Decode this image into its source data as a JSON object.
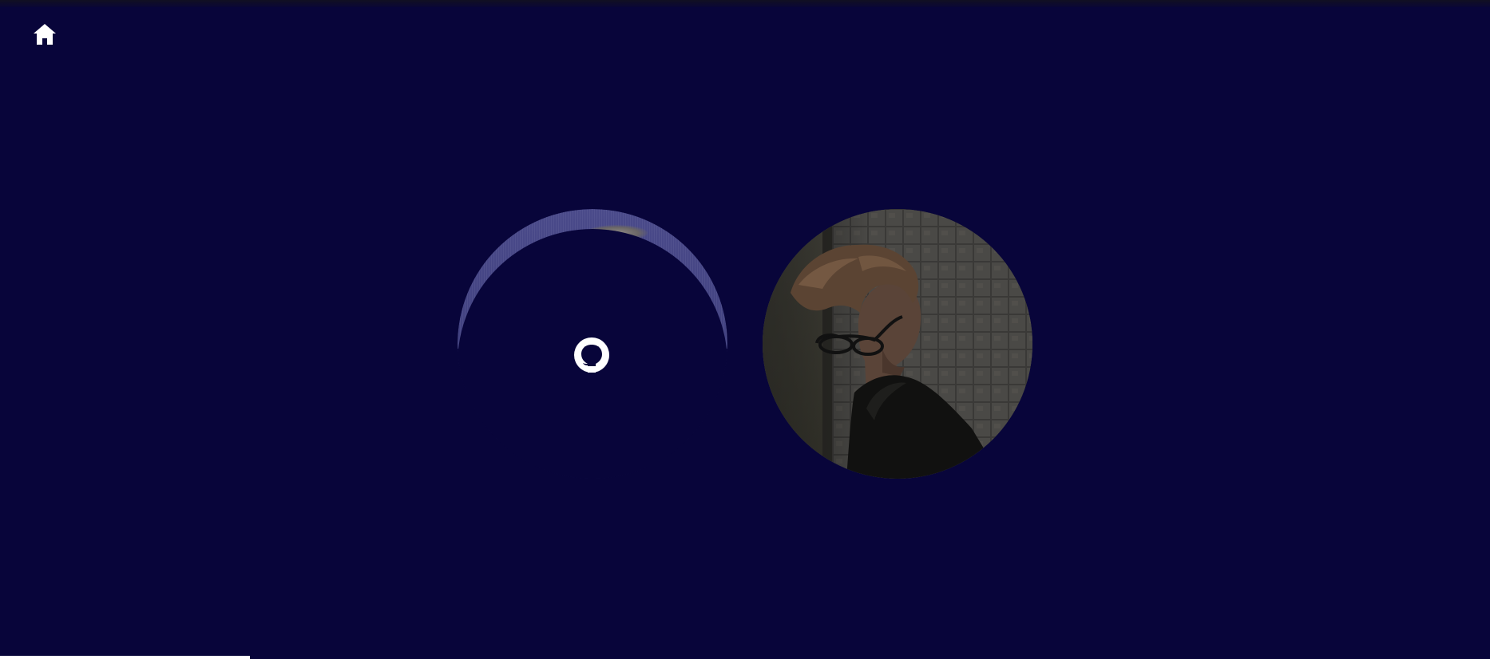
{
  "page": {
    "background_color": "#08053a",
    "accent_color": "#ffffff"
  },
  "nav": {
    "home_icon": "home-icon"
  },
  "links": [
    {
      "icon": "github-icon"
    }
  ],
  "profile": {
    "photo": "profile-photo"
  },
  "progress": {
    "fraction": 0.168
  }
}
